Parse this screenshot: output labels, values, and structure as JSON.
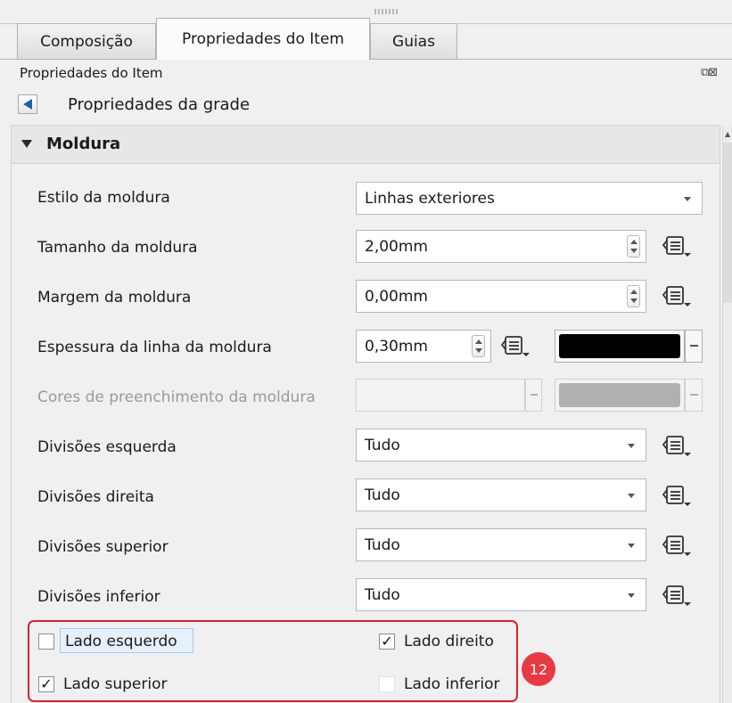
{
  "tabs": [
    "Composição",
    "Propriedades do Item",
    "Guias"
  ],
  "panel_title": "Propriedades do Item",
  "sub_title": "Propriedades da grade",
  "group_title": "Moldura",
  "rows": {
    "frame_style": {
      "label": "Estilo da moldura",
      "value": "Linhas exteriores"
    },
    "frame_size": {
      "label": "Tamanho da moldura",
      "value": "2,00mm"
    },
    "frame_margin": {
      "label": "Margem da moldura",
      "value": "0,00mm"
    },
    "frame_line": {
      "label": "Espessura da linha da moldura",
      "value": "0,30mm",
      "color": "#000000"
    },
    "fill_colors": {
      "label": "Cores de preenchimento da moldura",
      "color": "#b0b0b0"
    },
    "div_left": {
      "label": "Divisões esquerda",
      "value": "Tudo"
    },
    "div_right": {
      "label": "Divisões direita",
      "value": "Tudo"
    },
    "div_top": {
      "label": "Divisões superior",
      "value": "Tudo"
    },
    "div_bottom": {
      "label": "Divisões inferior",
      "value": "Tudo"
    }
  },
  "sides": {
    "left": {
      "label": "Lado esquerdo",
      "checked": false
    },
    "right": {
      "label": "Lado direito",
      "checked": true
    },
    "top": {
      "label": "Lado superior",
      "checked": true
    },
    "bottom": {
      "label": "Lado inferior",
      "checked": false
    }
  },
  "step_badge": "12",
  "colors": {
    "highlight": "#d8232a",
    "badge": "#e83a40"
  }
}
